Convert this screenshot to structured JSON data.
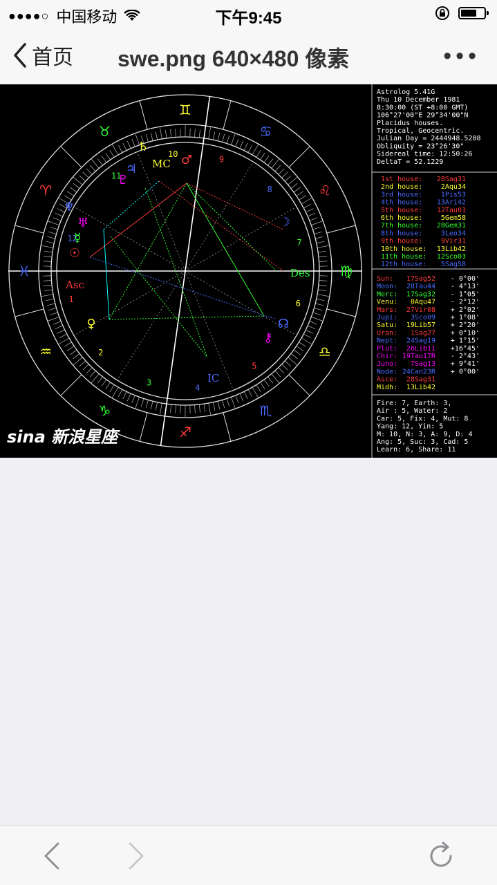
{
  "status_bar": {
    "signal_dots": "●●●●○",
    "carrier": "中国移动",
    "time": "下午9:45",
    "battery_level": 0.7
  },
  "nav": {
    "back_label": "首页",
    "title": "swe.png 640×480 像素",
    "more_label": "•••"
  },
  "chart": {
    "info_lines": [
      "Astrolog 5.41G",
      "Thu 10 December 1981",
      " 8:30:00 (ST +8:00 GMT)",
      "106°27'00\"E 29°34'00\"N",
      "Placidus houses.",
      "Tropical, Geocentric.",
      "Julian Day = 2444948.5208",
      "Obliquity = 23°26'30\"",
      "Sidereal time: 12:50:26",
      "DeltaT = 52.1229"
    ],
    "houses": [
      {
        "label": "1st house:",
        "value": "28Sag31",
        "color": "#ff3b3b"
      },
      {
        "label": "2nd house:",
        "value": "2Aqu34",
        "color": "#ffff33"
      },
      {
        "label": "3rd house:",
        "value": "1Pis53",
        "color": "#4a6bff"
      },
      {
        "label": "4th house:",
        "value": "13Ari42",
        "color": "#4a6bff"
      },
      {
        "label": "5th house:",
        "value": "12Tau03",
        "color": "#ff3b3b"
      },
      {
        "label": "6th house:",
        "value": "5Gem58",
        "color": "#ffff33"
      },
      {
        "label": "7th house:",
        "value": "28Gem31",
        "color": "#33ff33"
      },
      {
        "label": "8th house:",
        "value": "3Leo34",
        "color": "#4a6bff"
      },
      {
        "label": "9th house:",
        "value": "9Vir31",
        "color": "#ff3b3b"
      },
      {
        "label": "10th house:",
        "value": "13Lib42",
        "color": "#ffff33"
      },
      {
        "label": "11th house:",
        "value": "12Sco03",
        "color": "#33ff33"
      },
      {
        "label": "12th house:",
        "value": "5Sag58",
        "color": "#4a6bff"
      }
    ],
    "planets": [
      {
        "label": "Sun:",
        "value": "17Sag52",
        "extra": "- 0°00'",
        "color": "#ff3b3b"
      },
      {
        "label": "Moon:",
        "value": "28Tau44",
        "extra": "- 4°13'",
        "color": "#4a6bff"
      },
      {
        "label": "Merc:",
        "value": "17Sag32",
        "extra": "- 1°05'",
        "color": "#33ff33"
      },
      {
        "label": "Venu:",
        "value": "0Aqu47",
        "extra": "- 2°12'",
        "color": "#ffff33"
      },
      {
        "label": "Mars:",
        "value": "27Vir08",
        "extra": "+ 2°02'",
        "color": "#ff3b3b"
      },
      {
        "label": "Jupi:",
        "value": "3Sco09",
        "extra": "+ 1°08'",
        "color": "#4a6bff"
      },
      {
        "label": "Satu:",
        "value": "19Lib57",
        "extra": "+ 2°20'",
        "color": "#ffff33"
      },
      {
        "label": "Uran:",
        "value": "1Sag27",
        "extra": "+ 0°10'",
        "color": "#ff3b3b"
      },
      {
        "label": "Nept:",
        "value": "24Sag19",
        "extra": "+ 1°15'",
        "color": "#4a6bff"
      },
      {
        "label": "Plut:",
        "value": "26Lib11",
        "extra": "+16°45'",
        "color": "#ff00ff"
      },
      {
        "label": "Chir:",
        "value": "19Tau17R",
        "extra": "- 2°43'",
        "color": "#ff00ff"
      },
      {
        "label": "Juno:",
        "value": "7Sag13",
        "extra": "+ 9°41'",
        "color": "#ff00ff"
      },
      {
        "label": "Node:",
        "value": "24Can23R",
        "extra": "+ 0°00'",
        "color": "#4a6bff"
      },
      {
        "label": "Asce:",
        "value": "28Sag31",
        "extra": "",
        "color": "#ff3b3b"
      },
      {
        "label": "Midh:",
        "value": "13Lib42",
        "extra": "",
        "color": "#ffff33"
      }
    ],
    "summary_lines": [
      "Fire: 7, Earth: 3,",
      "Air : 5, Water: 2",
      "Car: 5, Fix: 4, Mut: 8",
      "Yang: 12, Yin: 5",
      "M: 10, N: 3, A: 9, D: 4",
      "Ang: 5, Suc: 3, Cad: 5",
      "Learn: 6, Share: 11"
    ],
    "house_numbers": [
      "1",
      "2",
      "3",
      "4",
      "5",
      "6",
      "7",
      "8",
      "9",
      "10",
      "11",
      "12"
    ],
    "angle_labels": {
      "asc": "Asc",
      "des": "Des",
      "mc": "MC",
      "ic": "IC"
    },
    "watermark": "sina 新浪星座"
  }
}
